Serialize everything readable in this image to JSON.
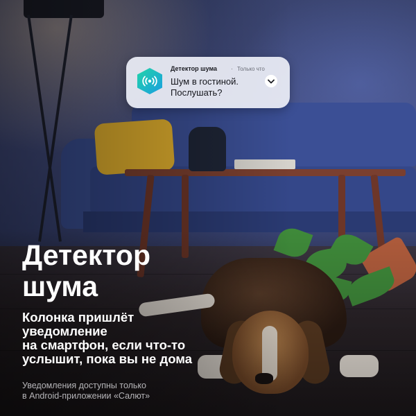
{
  "notification": {
    "app_name": "Детектор шума",
    "separator": "·",
    "time": "Только что",
    "message": "Шум в гостиной. Послушать?",
    "icon": "sound-waves-icon",
    "expand_icon": "chevron-down-icon"
  },
  "headline": [
    "Детектор",
    "шума"
  ],
  "subtitle": [
    "Колонка пришлёт",
    "уведомление",
    "на смартфон, если что-то",
    "услышит, пока вы не дома"
  ],
  "footnote": [
    "Уведомления доступны только",
    "в Android-приложении «Салют»"
  ],
  "colors": {
    "icon_gradient_start": "#22d4a8",
    "icon_gradient_end": "#1a9ee0",
    "card_background": "#eceef6",
    "text_primary": "#ffffff"
  }
}
